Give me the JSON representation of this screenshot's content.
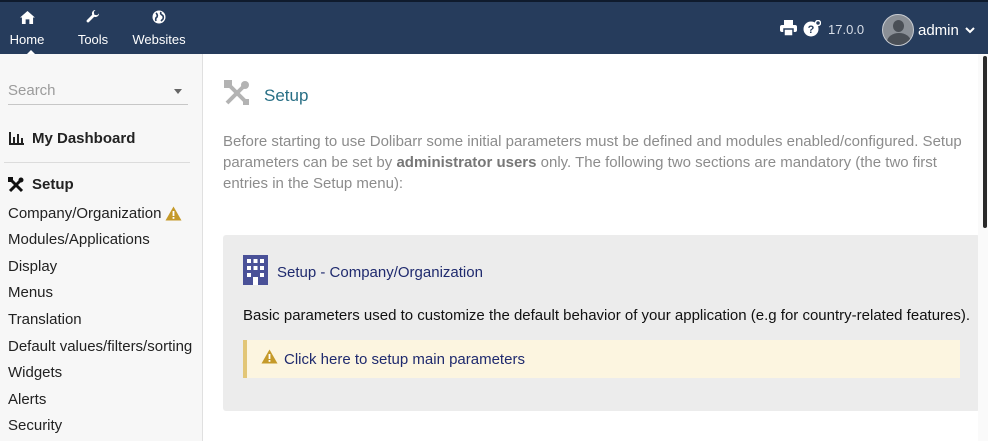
{
  "topbar": {
    "nav": [
      {
        "label": "Home",
        "icon": "home-icon"
      },
      {
        "label": "Tools",
        "icon": "wrench-icon"
      },
      {
        "label": "Websites",
        "icon": "globe-icon"
      }
    ],
    "version": "17.0.0",
    "user": "admin",
    "background": "#263c5c"
  },
  "sidebar": {
    "search_placeholder": "Search",
    "dashboard": "My Dashboard",
    "setup": "Setup",
    "items": [
      "Company/Organization",
      "Modules/Applications",
      "Display",
      "Menus",
      "Translation",
      "Default values/filters/sorting",
      "Widgets",
      "Alerts",
      "Security"
    ]
  },
  "main": {
    "title": "Setup",
    "intro_1": "Before starting to use Dolibarr some initial parameters must be defined and modules enabled/configured. Setup parameters can be set by ",
    "intro_bold": "administrator users",
    "intro_2": " only. The following two sections are mandatory (the two first entries in the Setup menu):",
    "card": {
      "title": "Setup - Company/Organization",
      "description": "Basic parameters used to customize the default behavior of your application (e.g for country-related features).",
      "notice": "Click here to setup main parameters"
    },
    "accent": "#286f85",
    "warning_color": "#c59a2a"
  }
}
